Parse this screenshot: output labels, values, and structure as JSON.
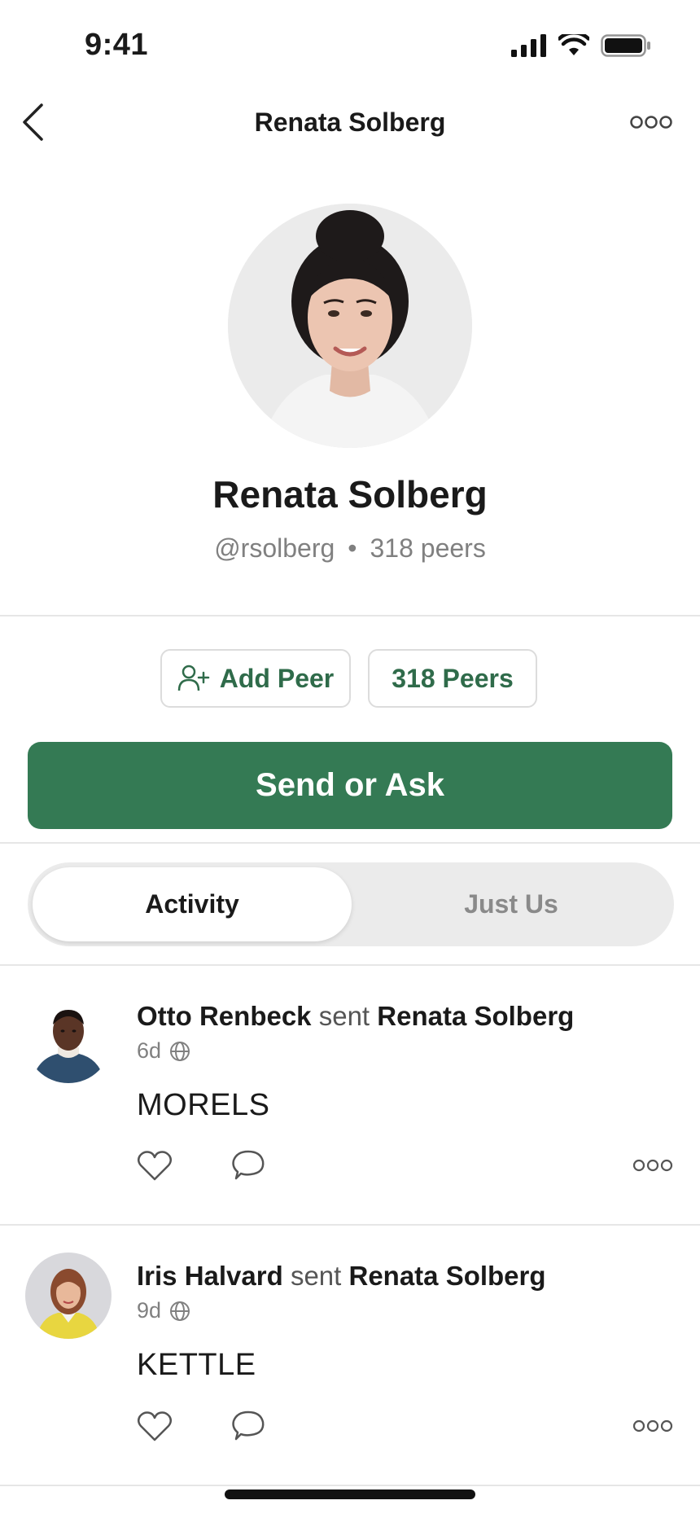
{
  "status_bar": {
    "time": "9:41"
  },
  "nav": {
    "title": "Renata Solberg"
  },
  "profile": {
    "name": "Renata Solberg",
    "handle": "@rsolberg",
    "separator": "•",
    "peers_text": "318 peers"
  },
  "actions": {
    "add_peer_label": "Add Peer",
    "peers_label": "318 Peers",
    "primary_label": "Send or Ask"
  },
  "tabs": [
    {
      "label": "Activity",
      "active": true
    },
    {
      "label": "Just Us",
      "active": false
    }
  ],
  "feed": [
    {
      "actor": "Otto Renbeck",
      "verb": "sent",
      "target": "Renata Solberg",
      "time": "6d",
      "note": "MORELS"
    },
    {
      "actor": "Iris Halvard",
      "verb": "sent",
      "target": "Renata Solberg",
      "time": "9d",
      "note": "KETTLE"
    }
  ],
  "colors": {
    "accent_green": "#347a54",
    "chip_text_green": "#2f6b4a",
    "muted_text": "#808080"
  }
}
